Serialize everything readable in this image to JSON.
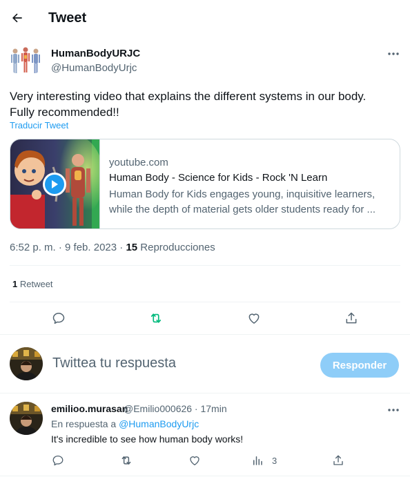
{
  "header": {
    "title": "Tweet"
  },
  "tweet": {
    "author_name": "HumanBodyURJC",
    "author_handle": "@HumanBodyUrjc",
    "text_line1": "Very interesting video that explains the different systems in our body.",
    "text_line2": "Fully recommended!!",
    "translate_label": "Traducir Tweet",
    "card": {
      "domain": "youtube.com",
      "title": "Human Body - Science for Kids - Rock 'N Learn",
      "desc_line1": "Human Body for Kids engages young, inquisitive learners,",
      "desc_line2": "while the depth of material gets older students ready for ..."
    },
    "timestamp": "6:52 p. m. · 9 feb. 2023 · ",
    "views_count": "15",
    "views_label": " Reproducciones",
    "retweet_count": "1",
    "retweet_label": " Retweet"
  },
  "composer": {
    "placeholder": "Twittea tu respuesta",
    "reply_button": "Responder"
  },
  "reply": {
    "name": "emilioo.murasan",
    "handle_time": "@Emilio000626 · 17min",
    "in_reply_prefix": "En respuesta a ",
    "in_reply_handle": "@HumanBodyUrjc",
    "text": "It's incredible to see how human body works!",
    "views": "3"
  },
  "colors": {
    "accent": "#1d9bf0",
    "retweet_active": "#00ba7c",
    "reply_button_bg": "#8ecdf8",
    "secondary_text": "#536471"
  },
  "icons": [
    "back-arrow-icon",
    "more-icon",
    "play-icon",
    "reply-icon",
    "retweet-icon",
    "like-icon",
    "share-icon",
    "views-icon"
  ]
}
